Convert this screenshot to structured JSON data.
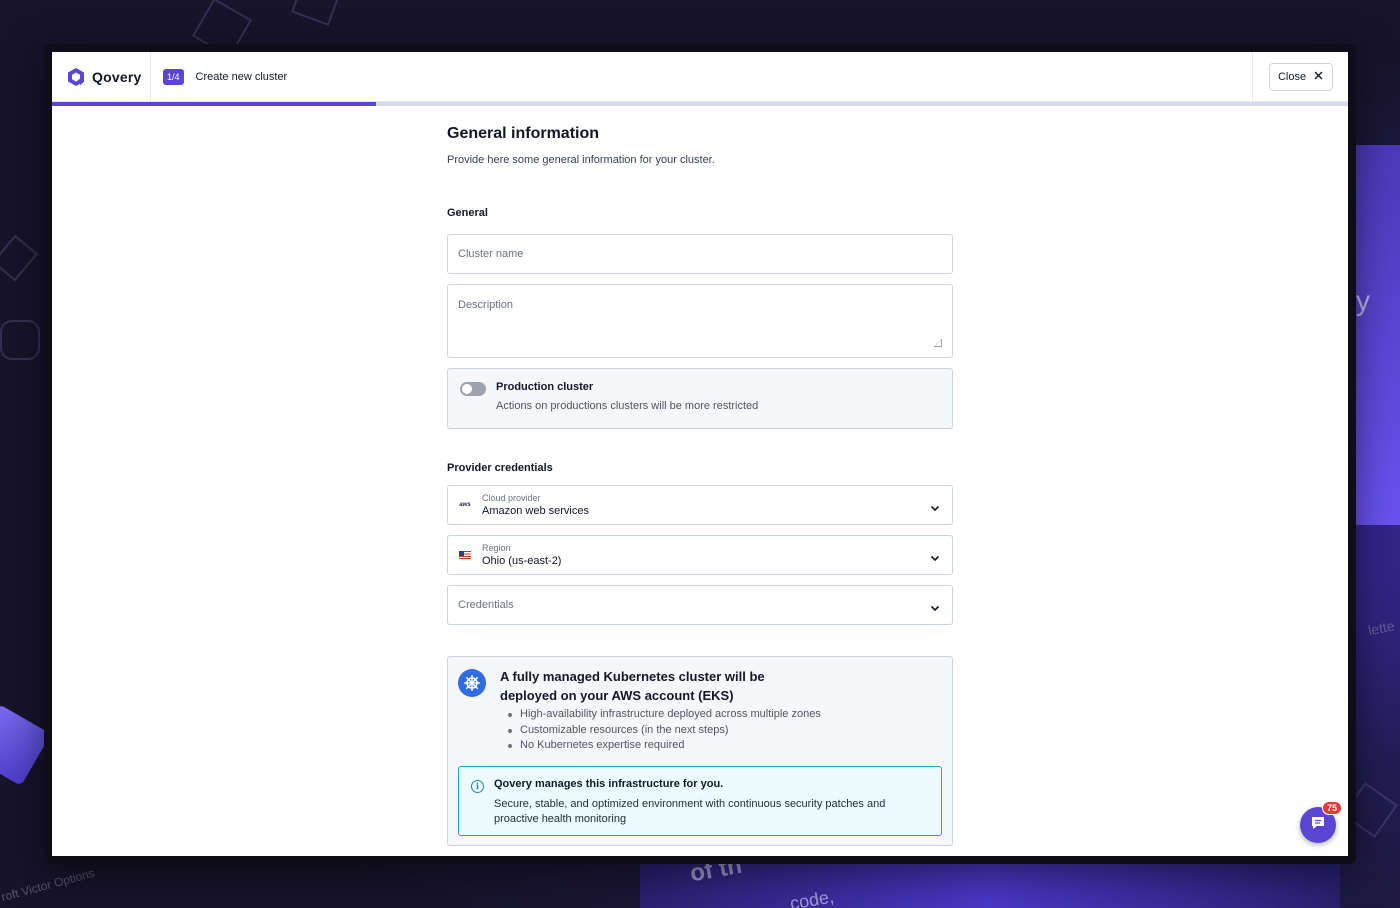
{
  "brand": {
    "name": "Qovery"
  },
  "header": {
    "step_badge": "1/4",
    "title": "Create new cluster",
    "close_label": "Close"
  },
  "progress": {
    "value": 0.25
  },
  "page": {
    "title": "General information",
    "subtitle": "Provide here some general information for your cluster."
  },
  "general": {
    "section_label": "General",
    "cluster_name_placeholder": "Cluster name",
    "description_placeholder": "Description",
    "production": {
      "title": "Production cluster",
      "description": "Actions on productions clusters will be more restricted",
      "enabled": false
    }
  },
  "provider": {
    "section_label": "Provider credentials",
    "cloud_provider": {
      "label": "Cloud provider",
      "value": "Amazon web services",
      "icon": "aws-icon",
      "icon_text": "aws"
    },
    "region": {
      "label": "Region",
      "value": "Ohio (us-east-2)",
      "icon": "us-flag-icon"
    },
    "credentials": {
      "placeholder": "Credentials"
    }
  },
  "info_card": {
    "title": "A fully managed Kubernetes cluster will be deployed on your AWS account (EKS)",
    "bullets": [
      "High-availability infrastructure deployed across multiple zones",
      "Customizable resources (in the next steps)",
      "No Kubernetes expertise required"
    ],
    "note": {
      "title": "Qovery manages this infrastructure for you.",
      "text": "Secure, stable, and optimized environment with continuous security patches and proactive health monitoring"
    }
  },
  "chat": {
    "badge": "75"
  },
  "background": {
    "text_left": "roft Victor Options",
    "text_right": "lette",
    "text_bottom1": "of th",
    "text_bottom2": "code,",
    "text_edge": "y"
  },
  "colors": {
    "accent": "#5b46d4",
    "info_border": "#22a6c8",
    "kubernetes": "#326ce5",
    "badge": "#e53935"
  }
}
